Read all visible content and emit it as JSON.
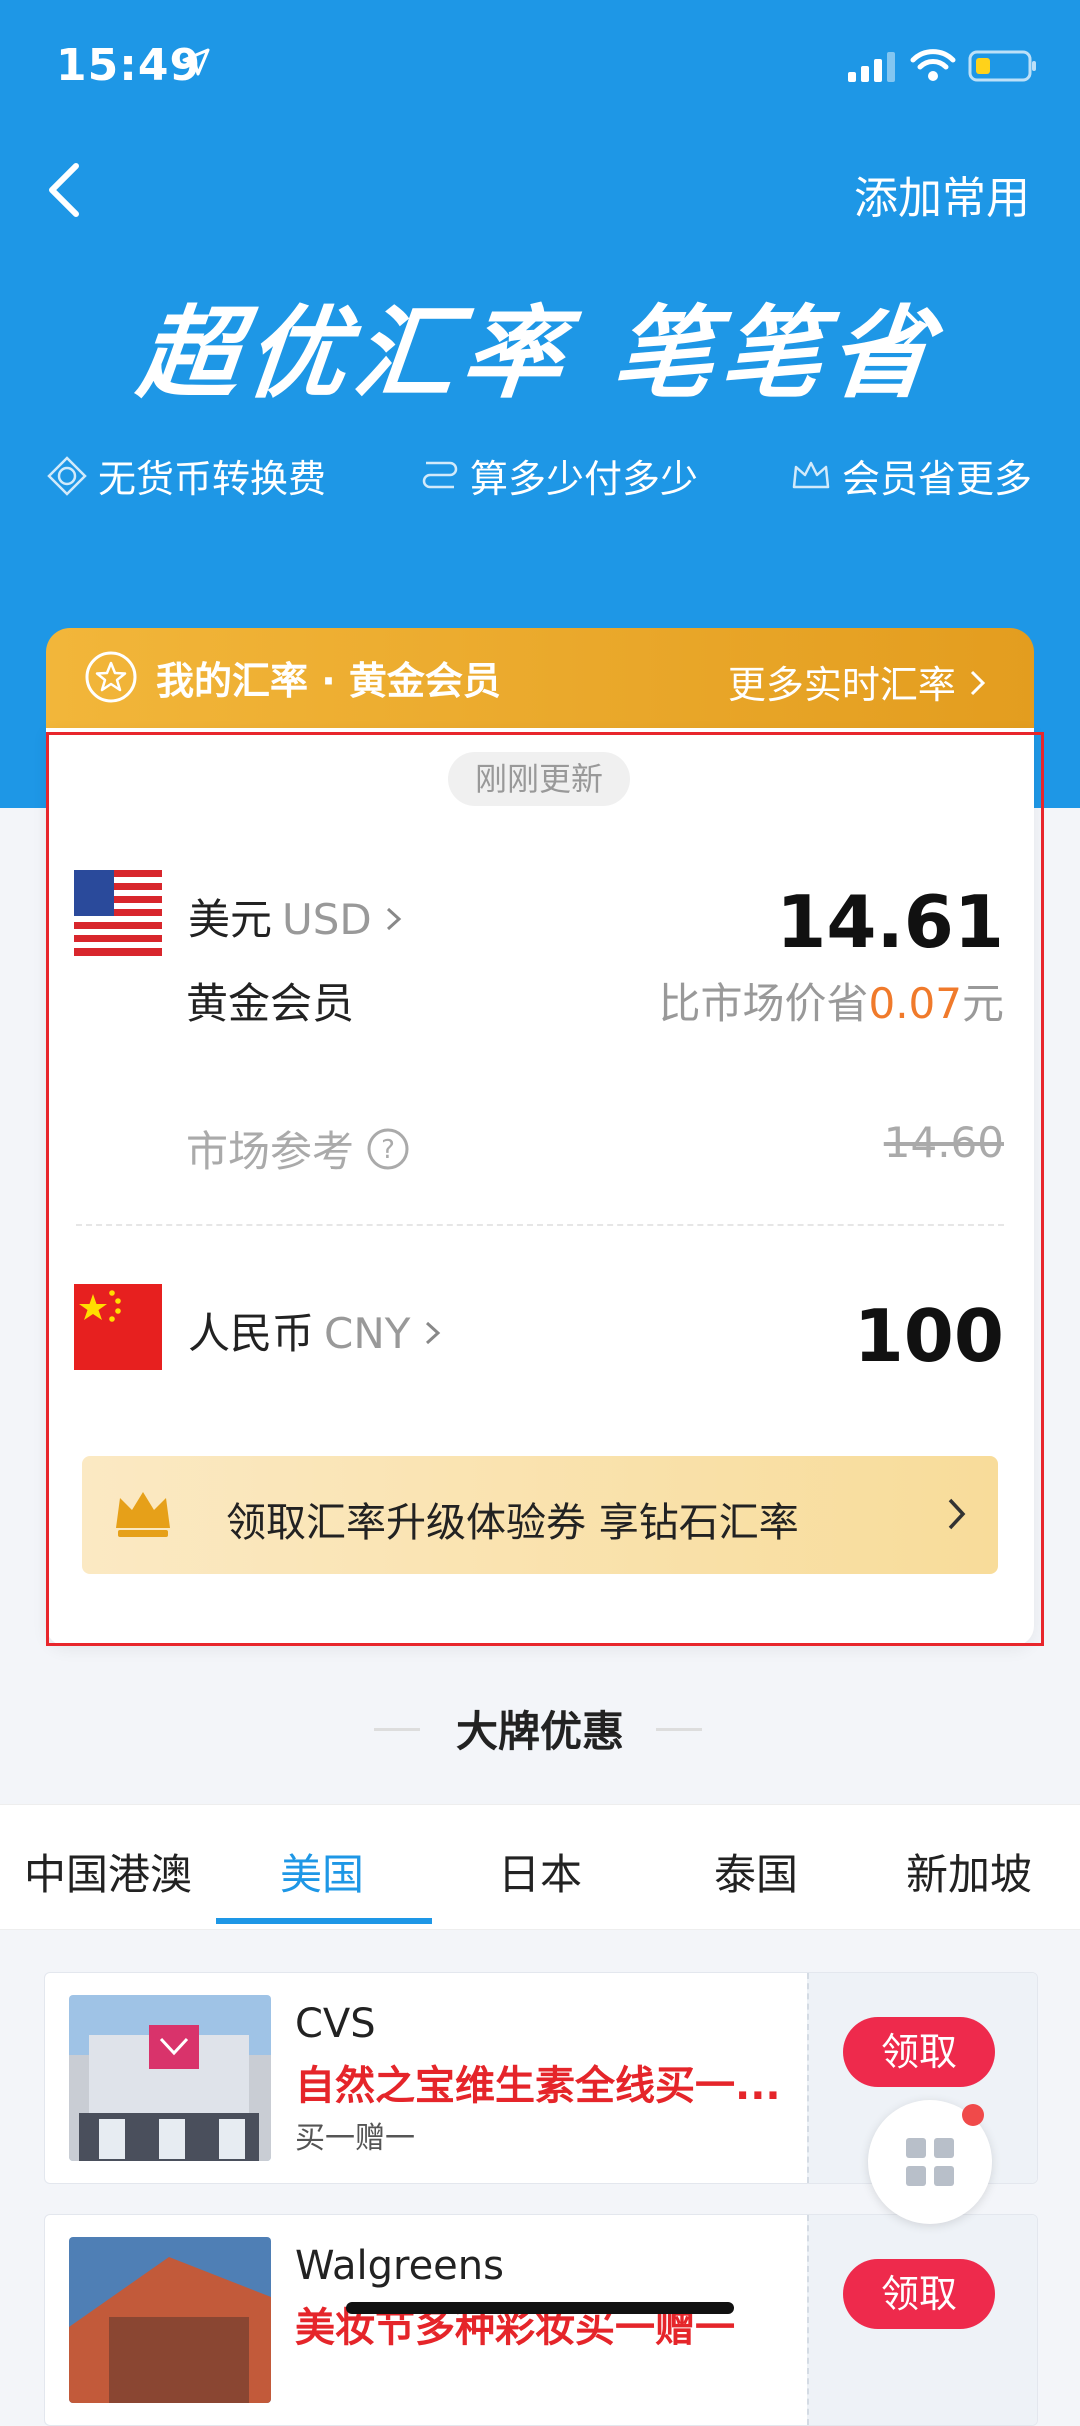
{
  "status_bar": {
    "time": "15:49"
  },
  "header": {
    "add_common": "添加常用"
  },
  "banner": {
    "title": "超优汇率 笔笔省"
  },
  "features": [
    {
      "label": "无货币转换费",
      "icon": "exchange-icon"
    },
    {
      "label": "算多少付多少",
      "icon": "calc-icon"
    },
    {
      "label": "会员省更多",
      "icon": "crown-icon"
    }
  ],
  "rate_card": {
    "header_title": "我的汇率 · 黄金会员",
    "more_link": "更多实时汇率",
    "update_pill": "刚刚更新",
    "from": {
      "name": "美元",
      "code": "USD",
      "value": "14.61"
    },
    "member_label": "黄金会员",
    "save_prefix": "比市场价省",
    "save_amount": "0.07",
    "save_suffix": "元",
    "market_label": "市场参考",
    "market_value": "14.60",
    "to": {
      "name": "人民币",
      "code": "CNY",
      "value": "100"
    },
    "coupon_text": "领取汇率升级体验券 享钻石汇率"
  },
  "brands": {
    "title": "大牌优惠",
    "tabs": [
      "中国港澳",
      "美国",
      "日本",
      "泰国",
      "新加坡"
    ],
    "active_tab": 1,
    "deals": [
      {
        "name": "CVS",
        "promo": "自然之宝维生素全线买一...",
        "sub": "买一赠一",
        "button": "领取"
      },
      {
        "name": "Walgreens",
        "promo": "美妆节多种彩妆买一赠一",
        "sub": "",
        "button": "领取"
      }
    ]
  },
  "colors": {
    "primary": "#1e97e6",
    "gold": "#e9a62a",
    "red": "#e5252a",
    "highlight_box": "#e8262c"
  }
}
